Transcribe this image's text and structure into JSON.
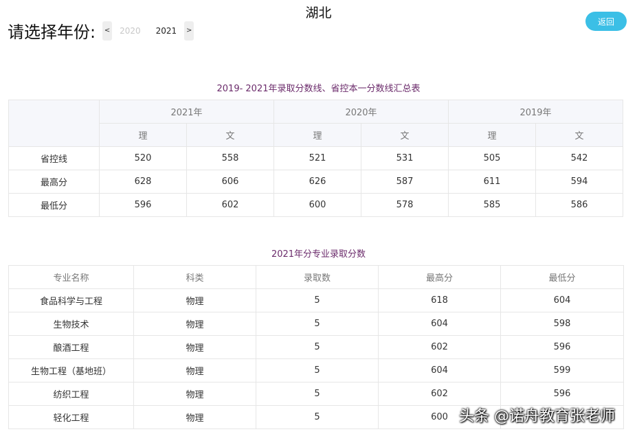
{
  "header": {
    "province": "湖北",
    "year_label": "请选择年份:",
    "prev_arrow": "<",
    "next_arrow": ">",
    "years": [
      "2020",
      "2021"
    ],
    "back_button": "返回"
  },
  "summary": {
    "title": "2019- 2021年录取分数线、省控本一分数线汇总表",
    "years": [
      "2021年",
      "2020年",
      "2019年"
    ],
    "subjects": [
      "理",
      "文",
      "理",
      "文",
      "理",
      "文"
    ],
    "rows": [
      {
        "label": "省控线",
        "values": [
          "520",
          "558",
          "521",
          "531",
          "505",
          "542"
        ]
      },
      {
        "label": "最高分",
        "values": [
          "628",
          "606",
          "626",
          "587",
          "611",
          "594"
        ]
      },
      {
        "label": "最低分",
        "values": [
          "596",
          "602",
          "600",
          "578",
          "585",
          "586"
        ]
      }
    ]
  },
  "majors": {
    "title": "2021年分专业录取分数",
    "columns": [
      "专业名称",
      "科类",
      "录取数",
      "最高分",
      "最低分"
    ],
    "rows": [
      [
        "食品科学与工程",
        "物理",
        "5",
        "618",
        "604"
      ],
      [
        "生物技术",
        "物理",
        "5",
        "604",
        "598"
      ],
      [
        "酿酒工程",
        "物理",
        "5",
        "602",
        "596"
      ],
      [
        "生物工程（基地班）",
        "物理",
        "5",
        "604",
        "599"
      ],
      [
        "纺织工程",
        "物理",
        "5",
        "602",
        "596"
      ],
      [
        "轻化工程",
        "物理",
        "5",
        "600",
        ""
      ]
    ]
  },
  "watermark": "头条 @诺舟教育张老师"
}
